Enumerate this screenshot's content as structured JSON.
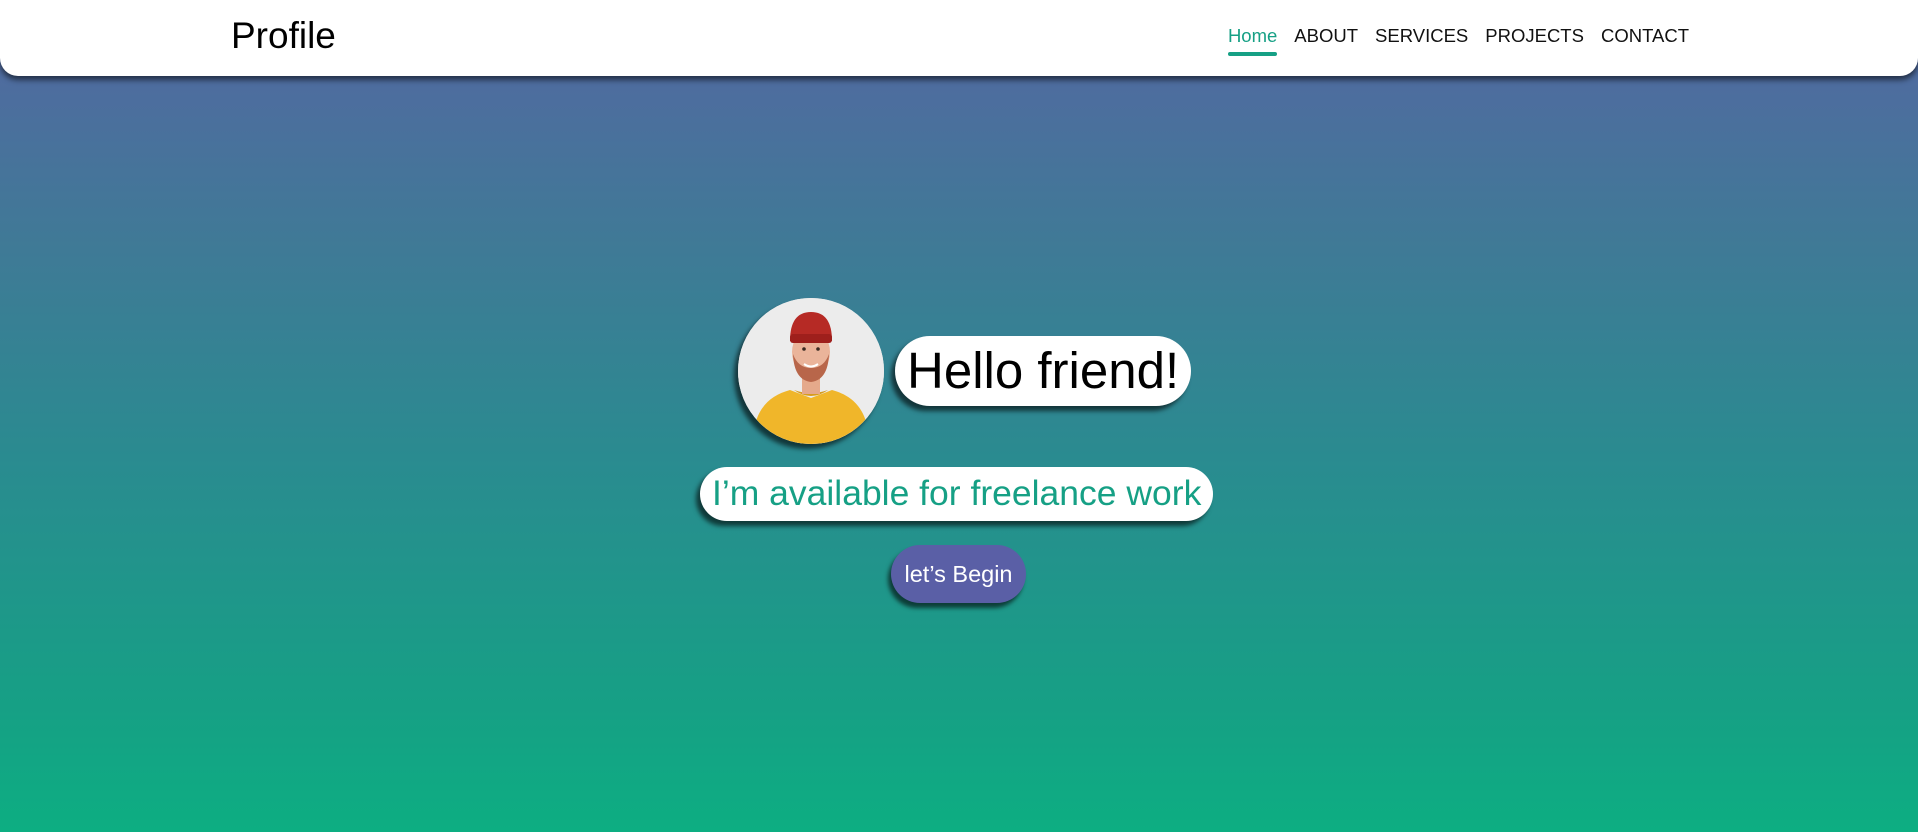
{
  "header": {
    "brand": "Profile",
    "nav": [
      {
        "label": "Home",
        "active": true
      },
      {
        "label": "ABOUT",
        "active": false
      },
      {
        "label": "SERVICES",
        "active": false
      },
      {
        "label": "PROJECTS",
        "active": false
      },
      {
        "label": "CONTACT",
        "active": false
      }
    ]
  },
  "hero": {
    "avatar_icon": "person-photo",
    "greeting": "Hello friend!",
    "tagline": "I’m available for freelance work",
    "cta_label": "let’s Begin"
  },
  "colors": {
    "accent": "#16a085",
    "button": "#5a5fa6",
    "gradient_top": "#5566a3",
    "gradient_bottom": "#0dae82",
    "nav_bg": "#ffffff"
  }
}
